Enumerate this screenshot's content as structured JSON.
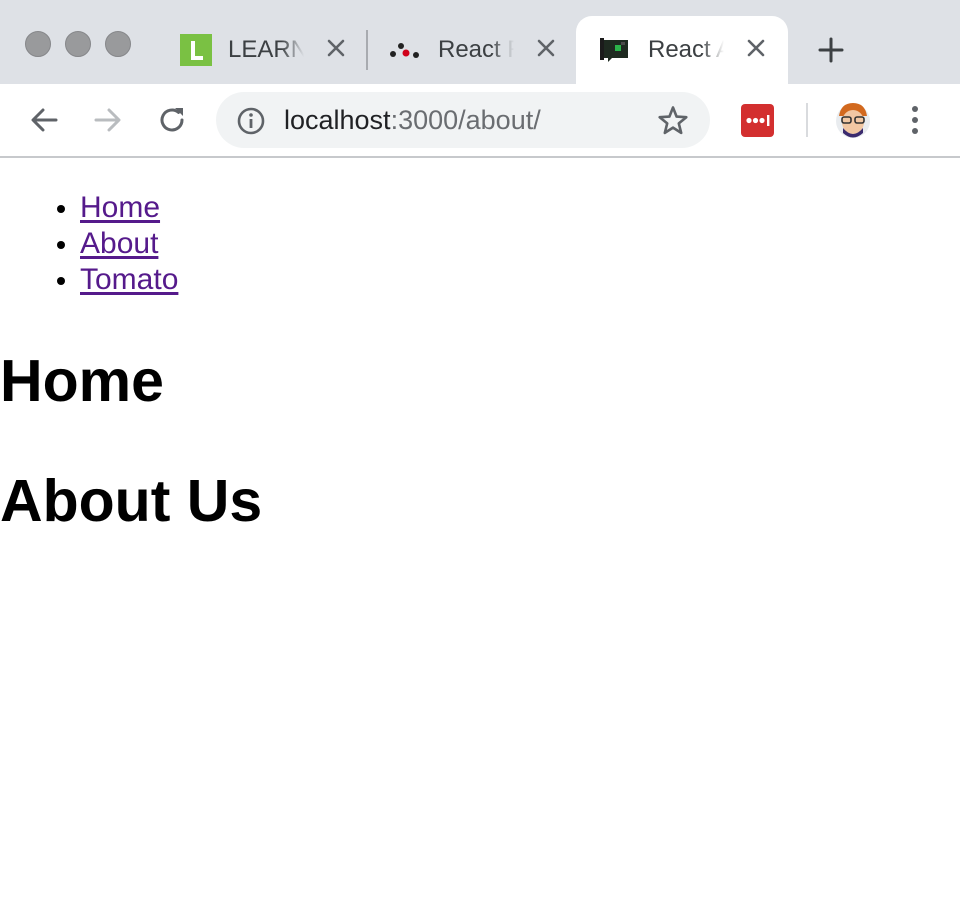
{
  "browser": {
    "tabs": [
      {
        "title": "LEARN",
        "favicon": "learn-favicon-icon",
        "active": false
      },
      {
        "title": "React R",
        "favicon": "react-router-favicon-icon",
        "active": false
      },
      {
        "title": "React A",
        "favicon": "react-app-favicon-icon",
        "active": true
      }
    ],
    "url": {
      "host": "localhost",
      "rest": ":3000/about/"
    },
    "extension_icon": "lastpass-icon",
    "colors": {
      "tabstrip": "#dee1e6",
      "active_tab": "#ffffff",
      "extension": "#d32f2f",
      "link": "#551a8b"
    }
  },
  "page": {
    "nav": {
      "items": [
        {
          "label": "Home"
        },
        {
          "label": "About"
        },
        {
          "label": "Tomato"
        }
      ]
    },
    "headings": {
      "home": "Home",
      "about": "About Us"
    }
  }
}
